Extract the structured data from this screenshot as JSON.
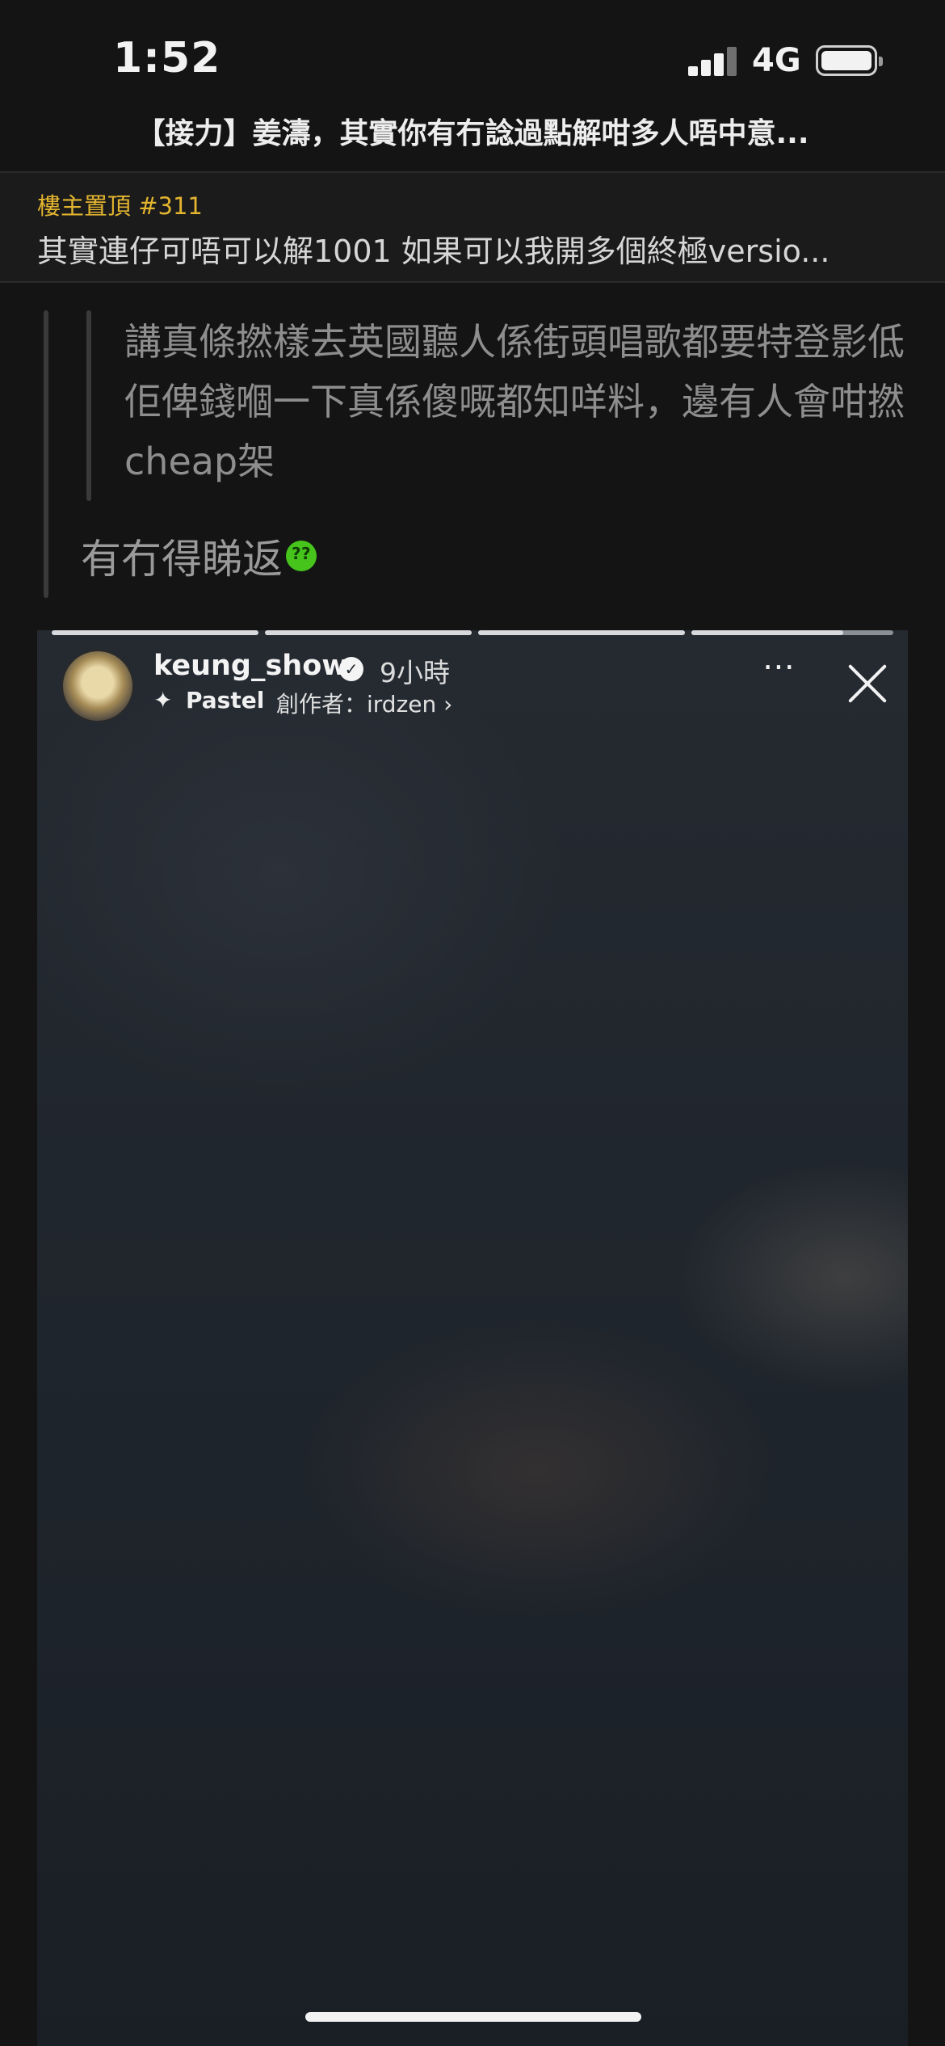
{
  "status_bar": {
    "time": "1:52",
    "network": "4G",
    "signal_bars": 4,
    "battery_level": 0.95
  },
  "thread": {
    "title": "【接力】姜濤，其實你有冇諗過點解咁多人唔中意..."
  },
  "pinned": {
    "label": "樓主置頂 #311",
    "text": "其實連仔可唔可以解1001 如果可以我開多個終極versio..."
  },
  "post": {
    "quote": "講真條撚樣去英國聽人係街頭唱歌都要特登影低佢俾錢嗰一下真係傻嘅都知咩料，邊有人會咁撚cheap架",
    "reply": "有冇得睇返",
    "emoji": "question-mark-emoji-icon"
  },
  "story": {
    "username": "keung_show",
    "verified": true,
    "age": "9小時",
    "effect_icon": "sparkle-icon",
    "effect_name": "Pastel",
    "creator": "創作者：irdzen ›",
    "more_icon": "⋯",
    "segments": [
      {
        "progress": 1.0
      },
      {
        "progress": 1.0
      },
      {
        "progress": 1.0
      },
      {
        "progress": 0.75
      }
    ]
  },
  "colors": {
    "background": "#141414",
    "pinned_accent": "#e3b52f",
    "emoji_green": "#46c41c"
  }
}
